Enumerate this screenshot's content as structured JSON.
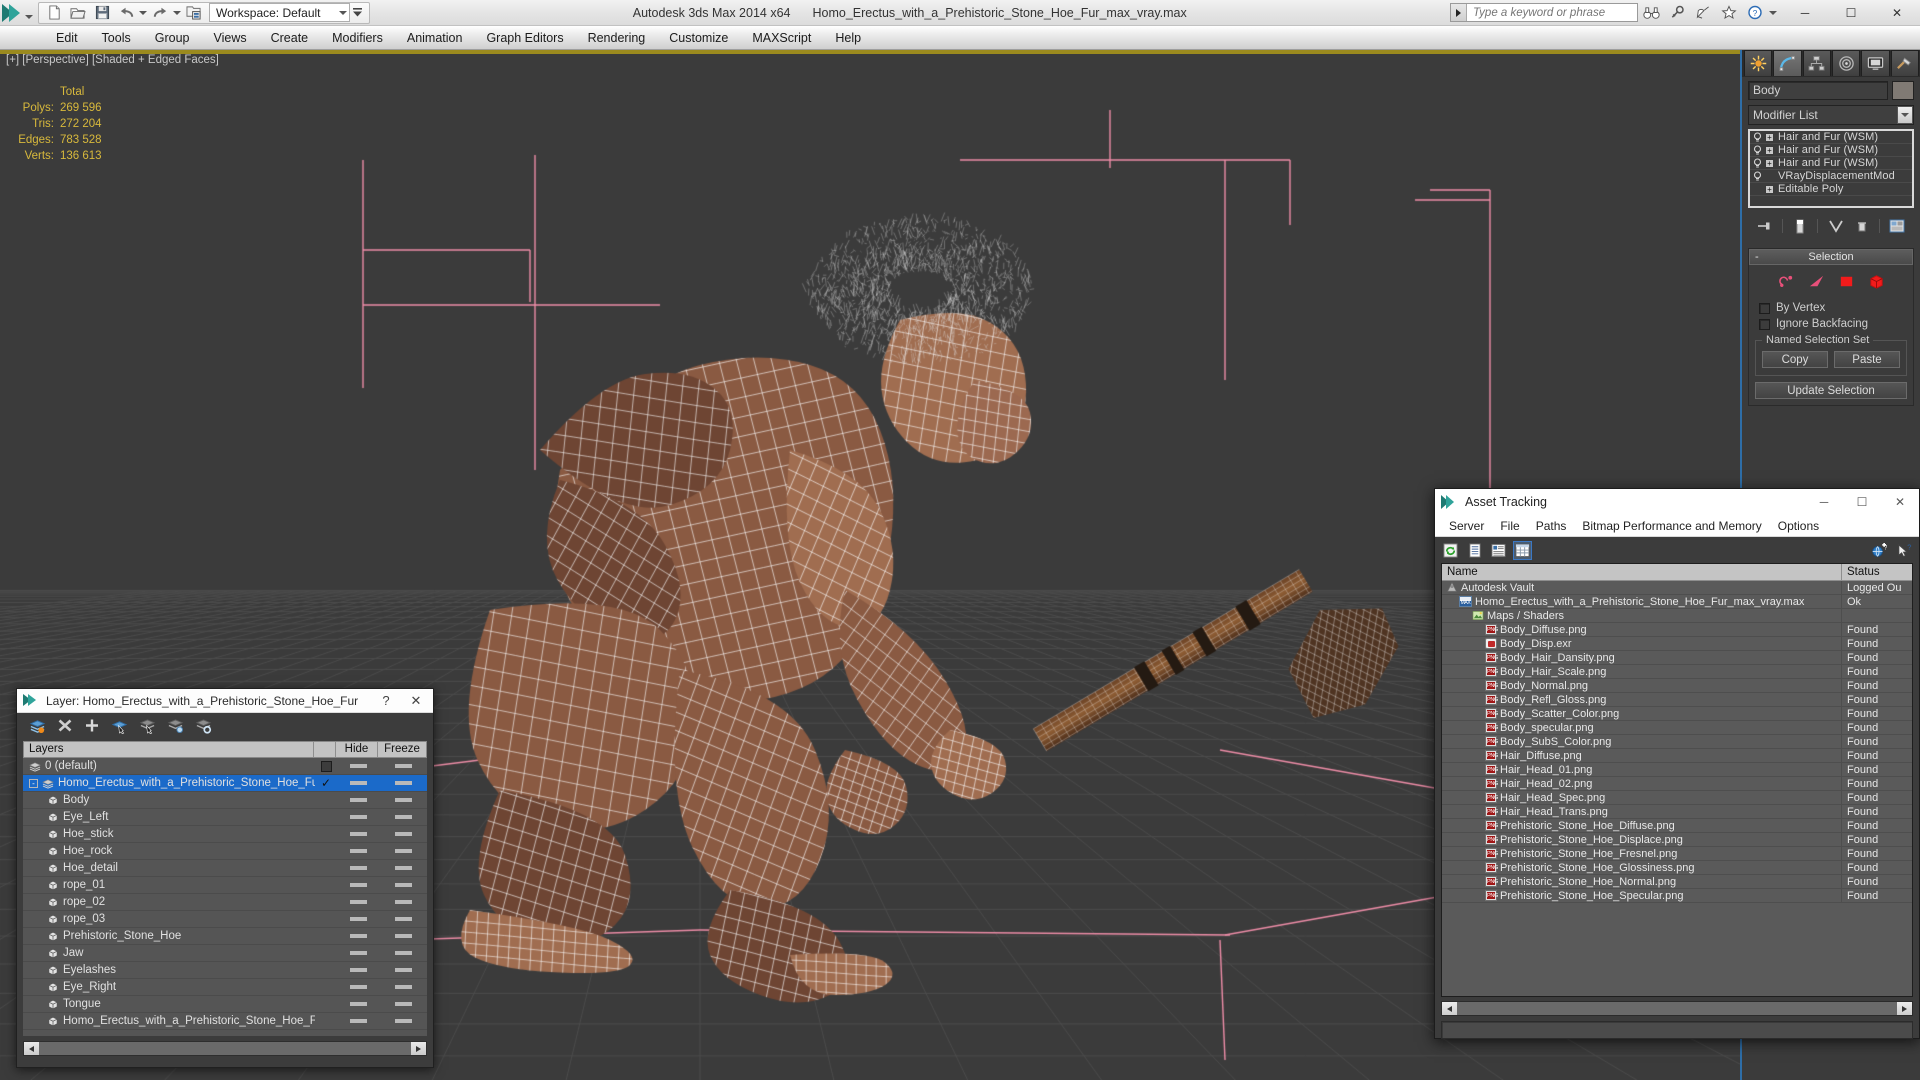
{
  "app": {
    "title": "Autodesk 3ds Max  2014 x64",
    "file_name": "Homo_Erectus_with_a_Prehistoric_Stone_Hoe_Fur_max_vray.max",
    "workspace_label": "Workspace: Default"
  },
  "quick_access": [
    {
      "name": "new-file-icon",
      "label": "New"
    },
    {
      "name": "open-file-icon",
      "label": "Open"
    },
    {
      "name": "save-file-icon",
      "label": "Save"
    },
    {
      "name": "undo-icon",
      "label": "Undo"
    },
    {
      "name": "redo-icon",
      "label": "Redo"
    },
    {
      "name": "project-folder-icon",
      "label": "Set Project Folder"
    }
  ],
  "search": {
    "placeholder": "Type a keyword or phrase"
  },
  "help_icons": [
    "binoculars-icon",
    "key-icon",
    "satellite-icon",
    "star-icon",
    "help-icon"
  ],
  "window_controls": {
    "minimize": "─",
    "maximize": "☐",
    "close": "✕"
  },
  "menu": {
    "items": [
      "Edit",
      "Tools",
      "Group",
      "Views",
      "Create",
      "Modifiers",
      "Animation",
      "Graph Editors",
      "Rendering",
      "Customize",
      "MAXScript",
      "Help"
    ]
  },
  "viewport": {
    "label": "[+] [Perspective] [Shaded + Edged Faces]",
    "stats": {
      "header": "Total",
      "rows": [
        {
          "key": "Polys:",
          "value": "269 596"
        },
        {
          "key": "Tris:",
          "value": "272 204"
        },
        {
          "key": "Edges:",
          "value": "783 528"
        },
        {
          "key": "Verts:",
          "value": "136 613"
        }
      ]
    },
    "colors": {
      "background": "#3b3b3b",
      "grid": "#4a4a4a",
      "helper_pink": "#ef8da8",
      "stats_text": "#d8b93c",
      "active_border": "#9b8a1e"
    }
  },
  "command_panel": {
    "tabs": [
      "create-tab",
      "modify-tab",
      "hierarchy-tab",
      "motion-tab",
      "display-tab",
      "utilities-tab"
    ],
    "active_tab_index": 1,
    "object_name": "Body",
    "object_color": "#807a74",
    "modifier_list_label": "Modifier List",
    "modifier_stack": [
      {
        "label": "Hair and Fur (WSM)",
        "has_bulb": true,
        "has_plus": true
      },
      {
        "label": "Hair and Fur (WSM)",
        "has_bulb": true,
        "has_plus": true
      },
      {
        "label": "Hair and Fur (WSM)",
        "has_bulb": true,
        "has_plus": true
      },
      {
        "label": "VRayDisplacementMod",
        "has_bulb": true,
        "has_plus": false
      },
      {
        "label": "Editable Poly",
        "has_bulb": false,
        "has_plus": true
      }
    ],
    "stack_buttons": [
      "pin-stack-icon",
      "show-end-result-icon",
      "make-unique-icon",
      "remove-modifier-icon",
      "configure-sets-icon"
    ],
    "selection_rollout": {
      "title": "Selection",
      "minus": "-",
      "sub_object_icons": [
        "vertex-icon",
        "edge-icon",
        "border-icon",
        "polygon-icon",
        "element-icon"
      ],
      "checkboxes": [
        {
          "label": "By Vertex",
          "checked": false
        },
        {
          "label": "Ignore Backfacing",
          "checked": false
        }
      ],
      "named_selection_set": {
        "title": "Named Selection Set",
        "copy": "Copy",
        "paste": "Paste"
      },
      "update_selection": "Update Selection"
    }
  },
  "layer_dialog": {
    "title": "Layer: Homo_Erectus_with_a_Prehistoric_Stone_Hoe_Fur",
    "help_glyph": "?",
    "close_glyph": "✕",
    "toolbar_icons": [
      "create-new-layer-icon",
      "delete-layer-icon",
      "add-layer-icon",
      "select-objects-in-layer-icon",
      "select-highlighted-objects-icon",
      "highlight-selected-objects-icon",
      "layer-properties-icon"
    ],
    "columns": {
      "name": "Layers",
      "hide": "Hide",
      "freeze": "Freeze"
    },
    "rows": [
      {
        "label": "0 (default)",
        "type": "layer",
        "indent": 1,
        "selected": false,
        "checkbox": true
      },
      {
        "label": "Homo_Erectus_with_a_Prehistoric_Stone_Hoe_Fur",
        "type": "layer",
        "indent": 1,
        "selected": true,
        "check": true,
        "expander": "-"
      },
      {
        "label": "Body",
        "type": "object",
        "indent": 2,
        "selected": false
      },
      {
        "label": "Eye_Left",
        "type": "object",
        "indent": 2,
        "selected": false
      },
      {
        "label": "Hoe_stick",
        "type": "object",
        "indent": 2,
        "selected": false
      },
      {
        "label": "Hoe_rock",
        "type": "object",
        "indent": 2,
        "selected": false
      },
      {
        "label": "Hoe_detail",
        "type": "object",
        "indent": 2,
        "selected": false
      },
      {
        "label": "rope_01",
        "type": "object",
        "indent": 2,
        "selected": false
      },
      {
        "label": "rope_02",
        "type": "object",
        "indent": 2,
        "selected": false
      },
      {
        "label": "rope_03",
        "type": "object",
        "indent": 2,
        "selected": false
      },
      {
        "label": "Prehistoric_Stone_Hoe",
        "type": "object",
        "indent": 2,
        "selected": false
      },
      {
        "label": "Jaw",
        "type": "object",
        "indent": 2,
        "selected": false
      },
      {
        "label": "Eyelashes",
        "type": "object",
        "indent": 2,
        "selected": false
      },
      {
        "label": "Eye_Right",
        "type": "object",
        "indent": 2,
        "selected": false
      },
      {
        "label": "Tongue",
        "type": "object",
        "indent": 2,
        "selected": false
      },
      {
        "label": "Homo_Erectus_with_a_Prehistoric_Stone_Hoe_Fur",
        "type": "object",
        "indent": 2,
        "selected": false
      }
    ]
  },
  "asset_tracking": {
    "title": "Asset Tracking",
    "menu": [
      "Server",
      "File",
      "Paths",
      "Bitmap Performance and Memory",
      "Options"
    ],
    "toolbar_icons": [
      "refresh-icon",
      "list-view-icon",
      "details-view-icon",
      "grid-view-icon"
    ],
    "toolbar_right_icons": [
      "help-globe-icon",
      "context-help-icon"
    ],
    "columns": {
      "name": "Name",
      "status": "Status"
    },
    "rows": [
      {
        "name": "Autodesk Vault",
        "status": "Logged Ou",
        "icon": "vault-icon",
        "indent": 1
      },
      {
        "name": "Homo_Erectus_with_a_Prehistoric_Stone_Hoe_Fur_max_vray.max",
        "status": "Ok",
        "icon": "max-icon",
        "indent": 2
      },
      {
        "name": "Maps / Shaders",
        "status": "",
        "icon": "maps-icon",
        "indent": 3
      },
      {
        "name": "Body_Diffuse.png",
        "status": "Found",
        "icon": "png-icon",
        "indent": 4
      },
      {
        "name": "Body_Disp.exr",
        "status": "Found",
        "icon": "exr-icon",
        "indent": 4
      },
      {
        "name": "Body_Hair_Dansity.png",
        "status": "Found",
        "icon": "png-icon",
        "indent": 4
      },
      {
        "name": "Body_Hair_Scale.png",
        "status": "Found",
        "icon": "png-icon",
        "indent": 4
      },
      {
        "name": "Body_Normal.png",
        "status": "Found",
        "icon": "png-icon",
        "indent": 4
      },
      {
        "name": "Body_Refl_Gloss.png",
        "status": "Found",
        "icon": "png-icon",
        "indent": 4
      },
      {
        "name": "Body_Scatter_Color.png",
        "status": "Found",
        "icon": "png-icon",
        "indent": 4
      },
      {
        "name": "Body_specular.png",
        "status": "Found",
        "icon": "png-icon",
        "indent": 4
      },
      {
        "name": "Body_SubS_Color.png",
        "status": "Found",
        "icon": "png-icon",
        "indent": 4
      },
      {
        "name": "Hair_Diffuse.png",
        "status": "Found",
        "icon": "png-icon",
        "indent": 4
      },
      {
        "name": "Hair_Head_01.png",
        "status": "Found",
        "icon": "png-icon",
        "indent": 4
      },
      {
        "name": "Hair_Head_02.png",
        "status": "Found",
        "icon": "png-icon",
        "indent": 4
      },
      {
        "name": "Hair_Head_Spec.png",
        "status": "Found",
        "icon": "png-icon",
        "indent": 4
      },
      {
        "name": "Hair_Head_Trans.png",
        "status": "Found",
        "icon": "png-icon",
        "indent": 4
      },
      {
        "name": "Prehistoric_Stone_Hoe_Diffuse.png",
        "status": "Found",
        "icon": "png-icon",
        "indent": 4
      },
      {
        "name": "Prehistoric_Stone_Hoe_Displace.png",
        "status": "Found",
        "icon": "png-icon",
        "indent": 4
      },
      {
        "name": "Prehistoric_Stone_Hoe_Fresnel.png",
        "status": "Found",
        "icon": "png-icon",
        "indent": 4
      },
      {
        "name": "Prehistoric_Stone_Hoe_Glossiness.png",
        "status": "Found",
        "icon": "png-icon",
        "indent": 4
      },
      {
        "name": "Prehistoric_Stone_Hoe_Normal.png",
        "status": "Found",
        "icon": "png-icon",
        "indent": 4
      },
      {
        "name": "Prehistoric_Stone_Hoe_Specular.png",
        "status": "Found",
        "icon": "png-icon",
        "indent": 4
      }
    ]
  }
}
